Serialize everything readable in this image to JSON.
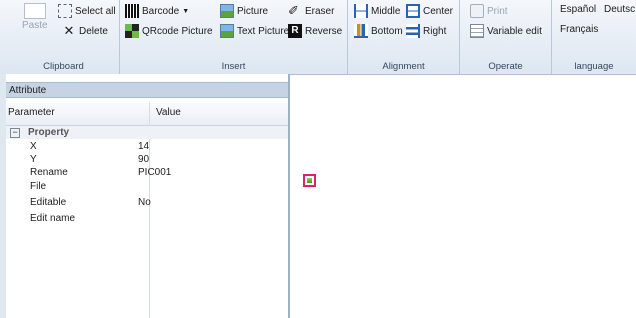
{
  "ribbon": {
    "clipboard": {
      "label": "Clipboard",
      "paste": "Paste",
      "select_all": "Select all",
      "delete": "Delete"
    },
    "insert": {
      "label": "Insert",
      "barcode": "Barcode",
      "qrcode_picture": "QRcode Picture",
      "picture": "Picture",
      "text_picture": "Text Picture",
      "eraser": "Eraser",
      "reverse": "Reverse"
    },
    "alignment": {
      "label": "Alignment",
      "middle": "Middle",
      "center": "Center",
      "bottom": "Bottom",
      "right": "Right"
    },
    "operate": {
      "label": "Operate",
      "print": "Print",
      "variable_edit": "Variable edit"
    },
    "language": {
      "label": "language",
      "espanol": "Español",
      "deutsch": "Deutsc",
      "francais": "Français"
    }
  },
  "panel": {
    "title": "Attribute",
    "columns": {
      "parameter": "Parameter",
      "value": "Value"
    },
    "category": "Property",
    "rows": [
      {
        "param": "X",
        "value": "14"
      },
      {
        "param": "Y",
        "value": "90"
      },
      {
        "param": "Rename",
        "value": "PIC001"
      },
      {
        "param": "File",
        "value": ""
      },
      {
        "param": "Editable",
        "value": "No"
      },
      {
        "param": "Edit name",
        "value": ""
      }
    ]
  },
  "icons": {
    "paste": "paste-icon",
    "select_all": "select-all-icon",
    "delete": "delete-x-icon",
    "barcode": "barcode-icon",
    "qrcode": "qrcode-icon",
    "picture": "picture-icon",
    "text_picture": "text-picture-icon",
    "eraser": "eraser-icon",
    "reverse": "reverse-icon",
    "middle": "align-middle-icon",
    "center": "align-center-icon",
    "bottom": "align-bottom-icon",
    "right": "align-right-icon",
    "print": "print-icon",
    "variable_edit": "variable-edit-icon"
  },
  "colors": {
    "ribbon_bg": "#dde6f1",
    "panel_title_bg": "#c6d3e3",
    "selection_border": "#e0206b"
  }
}
